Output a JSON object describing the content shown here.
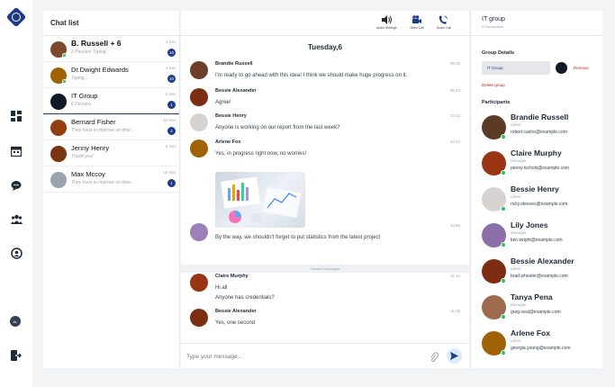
{
  "nav": {
    "icons": [
      "logo-icon",
      "dashboard-icon",
      "calendar-icon",
      "chat-icon",
      "team-icon",
      "support-icon",
      "avatar-icon",
      "logout-icon"
    ],
    "user_initials": "AL"
  },
  "chat_list": {
    "title": "Chat list",
    "items": [
      {
        "name": "B. Russell + 6",
        "sub": "2 Persons Typing...",
        "time": "4 min",
        "badge": "10",
        "bold": true,
        "online": true,
        "color": "#7c4a2d"
      },
      {
        "name": "Dr.Dwight Edwards",
        "sub": "Typing...",
        "time": "4 min",
        "badge": "10",
        "bold": false,
        "online": true,
        "color": "#a16207"
      },
      {
        "name": "IT Group",
        "sub": "6 Persons",
        "time": "8 min",
        "badge": "1",
        "bold": false,
        "online": false,
        "color": "#111827"
      },
      {
        "name": "Bernard Fisher",
        "sub": "They have to improve on time...",
        "time": "10 min",
        "badge": "2",
        "bold": false,
        "online": false,
        "color": "#92400e"
      },
      {
        "name": "Jenny Henry",
        "sub": "Thank you!",
        "time": "8 min",
        "badge": "",
        "bold": false,
        "online": false,
        "color": "#78350f"
      },
      {
        "name": "Max Mccoy",
        "sub": "They have to improve on time...",
        "time": "10 min",
        "badge": "1",
        "bold": false,
        "online": false,
        "color": "#9ca3af"
      }
    ]
  },
  "conversation": {
    "toolbar": {
      "audio_settings": "Audio Settings",
      "video_call": "Video Call",
      "audio_call": "Audio Call"
    },
    "day": "Tuesday,6",
    "messages": [
      {
        "name": "Brandie Russell",
        "time": "09:32",
        "lines": [
          "I'm ready to go ahead with this idea! I think we should make huge progress on it."
        ],
        "color": "#6b3f2a"
      },
      {
        "name": "Bessie Alexander",
        "time": "09:34",
        "lines": [
          "Agree!"
        ],
        "color": "#7c2d12"
      },
      {
        "name": "Bessie Henry",
        "time": "10:22",
        "lines": [
          "Anyone is working on our report from the last week?"
        ],
        "color": "#d6d3d1"
      },
      {
        "name": "Arlene Fox",
        "time": "10:34",
        "lines": [
          "Yes, in progress right now, no worries!"
        ],
        "color": "#a16207"
      },
      {
        "name": "Lily Jones",
        "time": "10:56",
        "lines": [
          "By the way, we shouldn't forget to put statistics from the latest project"
        ],
        "color": "#9d7fba"
      },
      {
        "name": "Claire Murphy",
        "time": "11:14",
        "lines": [
          "Hi all",
          "Anyone has credentials?"
        ],
        "color": "#9a3412"
      },
      {
        "name": "Bessie Alexander",
        "time": "11:15",
        "lines": [
          "Yes, one second"
        ],
        "color": "#7c2d12"
      }
    ],
    "unread_label": "Unread messages",
    "composer_placeholder": "Type your message..."
  },
  "group": {
    "title": "IT group",
    "subtitle": "6 Participants",
    "details_heading": "Group Details",
    "group_name": "IT Group",
    "remove_label": "Remove",
    "delete_label": "Delete group",
    "participants_heading": "Participants",
    "participants": [
      {
        "name": "Brandie Russell",
        "role": "Client",
        "email": "robert.castro@example.com",
        "color": "#5b3a26"
      },
      {
        "name": "Claire Murphy",
        "role": "Manager",
        "email": "penny.nichols@example.com",
        "color": "#9a3412"
      },
      {
        "name": "Bessie Henry",
        "role": "Client",
        "email": "ricky.steeves@example.com",
        "color": "#d6d3d1"
      },
      {
        "name": "Lily Jones",
        "role": "Manager",
        "email": "ken.wright@example.com",
        "color": "#8b6fa8"
      },
      {
        "name": "Bessie Alexander",
        "role": "Client",
        "email": "brad.wheeler@example.com",
        "color": "#7c2d12"
      },
      {
        "name": "Tanya Pena",
        "role": "Manager",
        "email": "greg.neal@example.com",
        "color": "#9f6b4f"
      },
      {
        "name": "Arlene Fox",
        "role": "Client",
        "email": "georgia.young@example.com",
        "color": "#a16207"
      }
    ]
  }
}
